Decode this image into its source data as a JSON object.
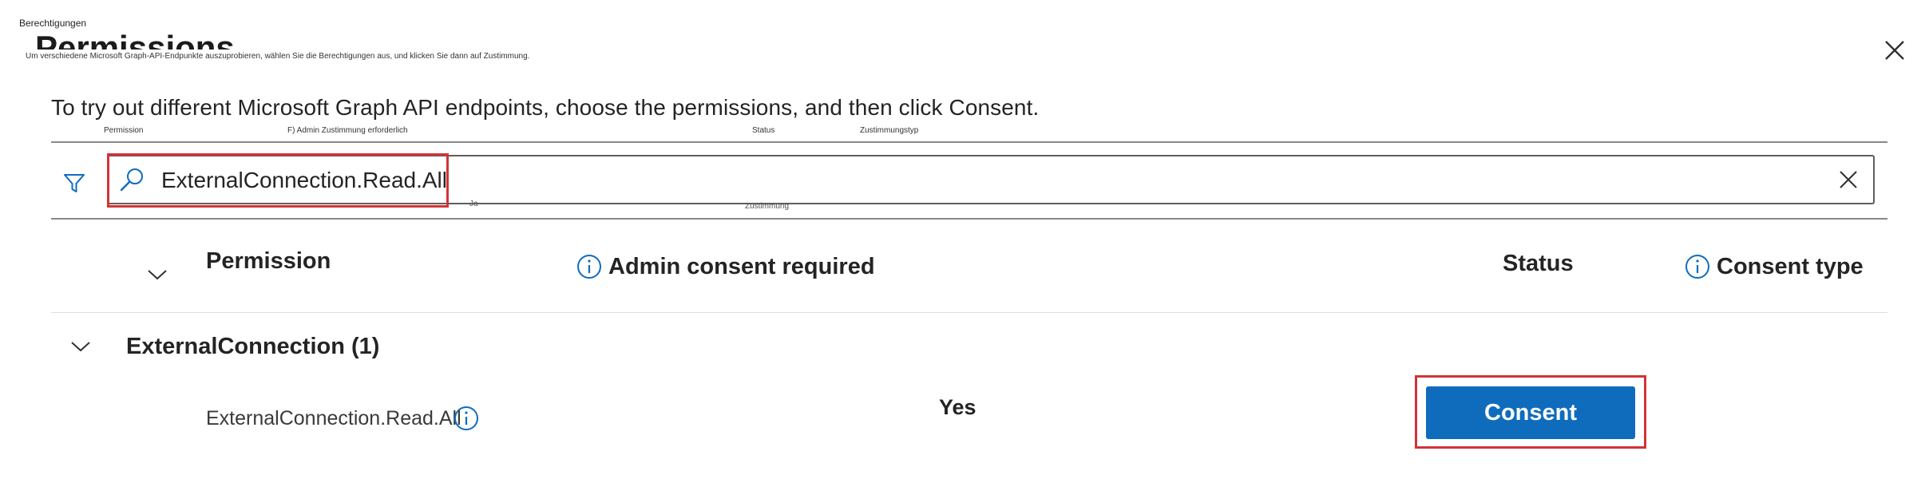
{
  "overlay": {
    "berechtigungen": "Berechtigungen",
    "german_instruction": "Um verschiedene Microsoft Graph-API-Endpunkte auszuprobieren, wählen Sie die Berechtigungen aus, und klicken Sie dann auf Zustimmung.",
    "col_permission": "Permission",
    "col_admin": "F) Admin Zustimmung erforderlich",
    "col_status": "Status",
    "col_consent_type": "Zustimmungstyp",
    "ja": "Ja",
    "zustimmung": "Zustimmung"
  },
  "panel": {
    "title": "Permissions",
    "instruction": "To try out different Microsoft Graph API endpoints, choose the permissions, and then click Consent."
  },
  "search": {
    "value": "ExternalConnection.Read.All"
  },
  "table": {
    "headers": {
      "permission": "Permission",
      "admin_consent": "Admin consent required",
      "status": "Status",
      "consent_type": "Consent type"
    },
    "group": {
      "label": "ExternalConnection (1)"
    },
    "rows": [
      {
        "permission": "ExternalConnection.Read.All",
        "admin_consent_required": "Yes",
        "action_label": "Consent"
      }
    ]
  },
  "colors": {
    "accent": "#0f6cbd",
    "highlight": "#d13438"
  },
  "icons": [
    "close-icon",
    "filter-icon",
    "search-icon",
    "clear-icon",
    "info-icon",
    "chevron-down-icon"
  ]
}
